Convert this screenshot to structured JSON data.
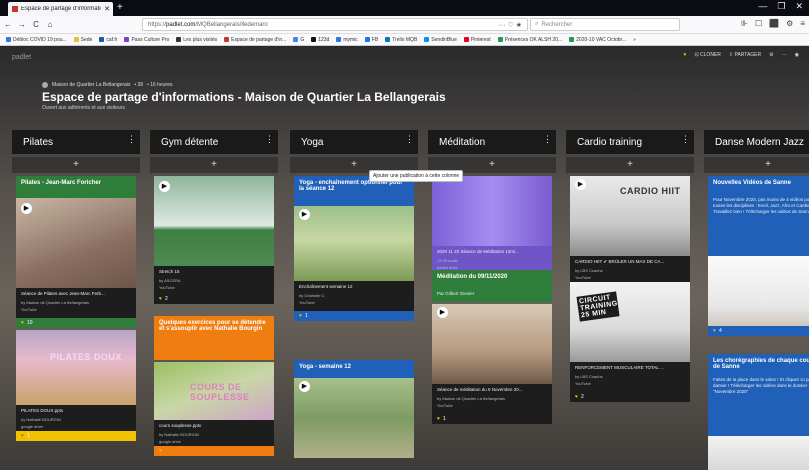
{
  "browser": {
    "tab_title": "Espace de partage d'informatio",
    "tab_close": "✕",
    "new_tab": "+",
    "back": "←",
    "forward": "→",
    "reload": "C",
    "home": "⌂",
    "url_prefix": "https://",
    "url_domain": "padlet.com",
    "url_path": "/MQBellangerais/lledemaro",
    "url_right": "··· ♡ ★",
    "search_placeholder": "Rechercher",
    "win_min": "—",
    "win_max": "❐",
    "win_close": "✕",
    "nav_right": [
      "⊪",
      "☐",
      "⬛",
      "⚙",
      "≡"
    ],
    "bookmarks": [
      {
        "label": "Débloc COVID 19 pou...",
        "color": "#2a7ae2"
      },
      {
        "label": "Sede",
        "color": "#e8c13a"
      },
      {
        "label": "caf.fr",
        "color": "#1a5ca8"
      },
      {
        "label": "Pass Culture Pro",
        "color": "#7a44c7"
      },
      {
        "label": "Les plus visités",
        "color": "#333"
      },
      {
        "label": "Espace de partage d'in...",
        "color": "#c0392b"
      },
      {
        "label": "G",
        "color": "#4285f4"
      },
      {
        "label": "123d",
        "color": "#111"
      },
      {
        "label": "mymic",
        "color": "#2a7ae2"
      },
      {
        "label": "FB",
        "color": "#1877f2"
      },
      {
        "label": "Trello MQB",
        "color": "#0079bf"
      },
      {
        "label": "SendinBlue",
        "color": "#0092ff"
      },
      {
        "label": "Pinterest",
        "color": "#e60023"
      },
      {
        "label": "Présences OK ALSH 20...",
        "color": "#1d9e58"
      },
      {
        "label": "2020-10 VAC Octobr...",
        "color": "#1d9e58"
      }
    ],
    "bm_more": "»"
  },
  "padlet": {
    "logo": "padlet",
    "top_right": [
      "♥",
      "⊡ CLONER",
      "⇧ PARTAGER",
      "⚙",
      "···",
      "◉"
    ],
    "breadcrumb": [
      "Maison de Quartier La Bellangerais",
      "• 38",
      "• 16 heures"
    ],
    "title": "Espace de partage d'informations - Maison de Quartier La Bellangerais",
    "subtitle": "Ouvert aux adhérents et aux visiteurs",
    "tooltip": "Ajouter une publication à cette colonne",
    "add_symbol": "+",
    "col_menu": "⋮",
    "columns": [
      {
        "title": "Pilates",
        "cards": [
          {
            "title": "Pilates - Jean-Marc Foricher",
            "text": "Séance de Pilates avec Jean-Marc Ferb...",
            "by": "by Maison de Quartier La Bellangerais",
            "src": "YouTube",
            "likes": "10"
          },
          {
            "banner": "PILATES DOUX",
            "text": "PILATES DOUX.pptx",
            "by": "by Nathalie BOURGIN",
            "src": "google drive",
            "likes": "1"
          }
        ]
      },
      {
        "title": "Gym détente",
        "cards": [
          {
            "text": "Stretch 15",
            "by": "by ASCERA",
            "src": "YouTube",
            "likes": "2"
          },
          {
            "title": "Quelques exercices pour se détendre et s'assouplir avec Nathalie Bourgin"
          },
          {
            "banner": "COURS DE SOUPLESSE",
            "text": "cours souplesse.pptx",
            "by": "by Nathalie BOURGIN",
            "src": "google drive",
            "likes": ""
          }
        ]
      },
      {
        "title": "Yoga",
        "cards": [
          {
            "title": "Yoga - enchaînement optionnel pour la séance 12",
            "text": "Enchaînement semaine 12",
            "by": "by Charlotte C",
            "src": "YouTube",
            "likes": "1"
          },
          {
            "title": "Yoga - semaine 12"
          }
        ]
      },
      {
        "title": "Méditation",
        "cards": [
          {
            "text": "2020 11 20 Séance de Méditation 13mi...",
            "by": "13.49 audio",
            "src": "padlet drive",
            "likes": ""
          },
          {
            "title": "Méditation du 09/11/2020",
            "text": "Par Gilbert Gieoler",
            "likes": ""
          },
          {
            "text": "Séance de méditation du 9 Novembre 20...",
            "by": "by Maison de Quartier La Bellangerais",
            "src": "YouTube",
            "likes": "1"
          }
        ]
      },
      {
        "title": "Cardio training",
        "cards": [
          {
            "banner": "CARDIO HIIT",
            "text": "CARDIO HIIT ✔ BRÛLER UN MAX DE CA...",
            "by": "by LBS Coachs",
            "src": "YouTube",
            "likes": ""
          },
          {
            "banner": "CIRCUIT TRAINING 25 MIN",
            "text": "RENFORCEMENT MUSCULAIRE TOTAL ...",
            "by": "by LBS Coachs",
            "src": "YouTube",
            "likes": "2"
          }
        ]
      },
      {
        "title": "Danse Modern Jazz",
        "cards": [
          {
            "title": "Nouvelles Vidéos de Sanne",
            "text": "Pour Novembre 2020, pas moins de 4 vidéos pour toutes les disciplines : Eveil, Jazz, Afro et Cardio. Travaillez bien ! Télécharger les vidéos de Sanne",
            "likes": "4"
          },
          {
            "title": "Les chorégraphies de chaque cours de Sanne",
            "text": "Faites de la place dans le salon ! Et cliquez ici pour danser ! Télécharger les vidéos dans le dossier \"Novembre 2020\""
          }
        ]
      }
    ]
  }
}
